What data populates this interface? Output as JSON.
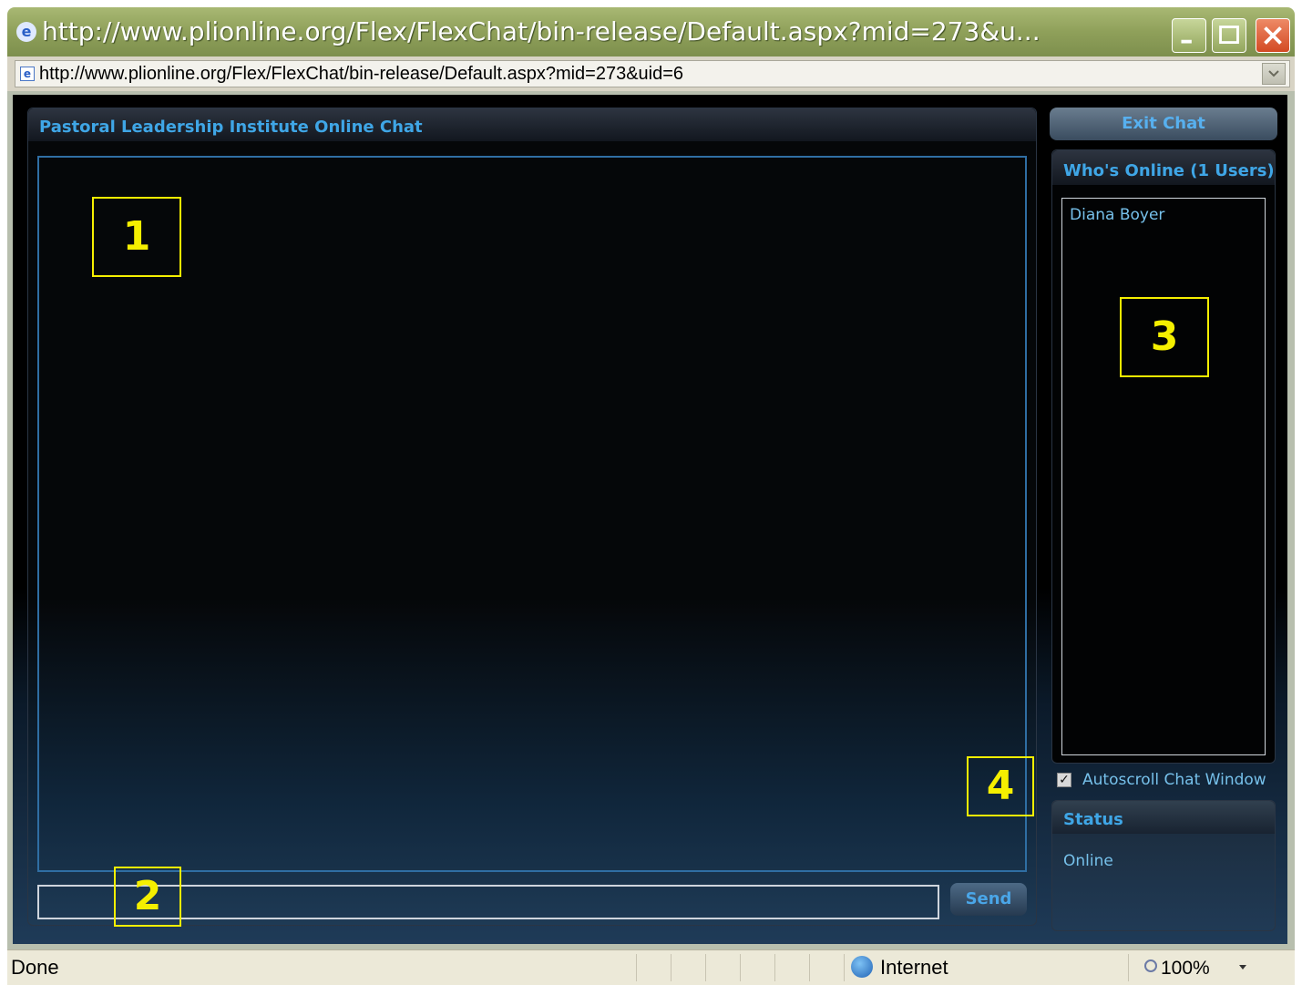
{
  "window": {
    "title": "http://www.plionline.org/Flex/FlexChat/bin-release/Default.aspx?mid=273&u...",
    "icon": "ie-icon",
    "controls": {
      "minimize": "minimize-icon",
      "maximize": "maximize-icon",
      "close": "close-icon"
    }
  },
  "address": {
    "url": "http://www.plionline.org/Flex/FlexChat/bin-release/Default.aspx?mid=273&uid=6"
  },
  "chat": {
    "title": "Pastoral Leadership Institute Online Chat",
    "send_label": "Send",
    "input_value": ""
  },
  "sidebar": {
    "exit_label": "Exit Chat",
    "online_title": "Who's Online (1 Users)",
    "users": [
      "Diana Boyer"
    ],
    "autoscroll_label": "Autoscroll Chat Window",
    "autoscroll_checked": true,
    "status_title": "Status",
    "status_value": "Online"
  },
  "callouts": [
    "1",
    "2",
    "3",
    "4"
  ],
  "statusbar": {
    "text": "Done",
    "zone": "Internet",
    "zoom": "100%"
  },
  "colors": {
    "accent": "#3fa6e6",
    "callout": "#f5ef00",
    "titlebar": "#8fa05a"
  }
}
